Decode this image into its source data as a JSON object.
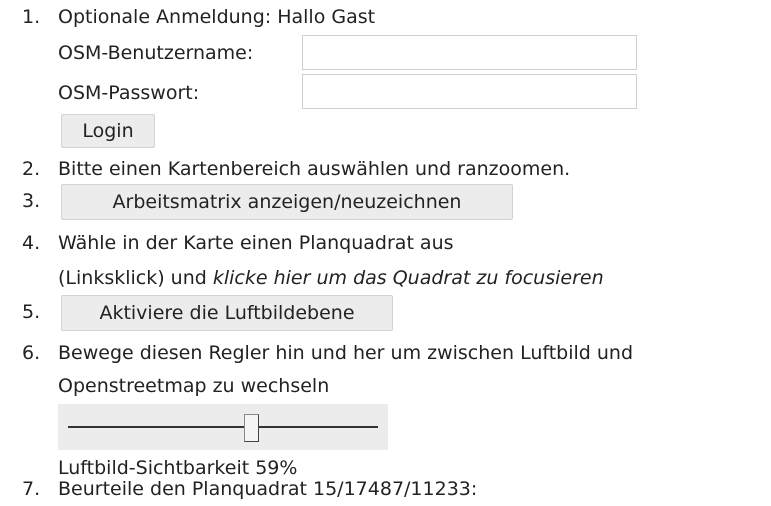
{
  "steps": {
    "s1": {
      "num": "1.",
      "text": "Optionale Anmeldung: Hallo Gast"
    },
    "login": {
      "username_label": "OSM-Benutzername:",
      "username_value": "",
      "password_label": "OSM-Passwort:",
      "password_value": "",
      "login_button": "Login"
    },
    "s2": {
      "num": "2.",
      "text": "Bitte einen Kartenbereich auswählen und ranzoomen."
    },
    "s3": {
      "num": "3.",
      "button": "Arbeitsmatrix anzeigen/neuzeichnen"
    },
    "s4": {
      "num": "4.",
      "line1": "Wähle in der Karte einen Planquadrat aus",
      "line2_prefix": "(Linksklick) und ",
      "line2_link": "klicke hier um das Quadrat zu focusieren"
    },
    "s5": {
      "num": "5.",
      "button": "Aktiviere die Luftbildebene"
    },
    "s6": {
      "num": "6.",
      "line1": "Bewege diesen Regler hin und her um zwischen Luftbild und",
      "line2": "Openstreetmap zu wechseln",
      "slider_value": 0.59,
      "visibility_text": "Luftbild-Sichtbarkeit 59%"
    },
    "s7": {
      "num": "7.",
      "text": "Beurteile den Planquadrat 15/17487/11233:"
    }
  }
}
